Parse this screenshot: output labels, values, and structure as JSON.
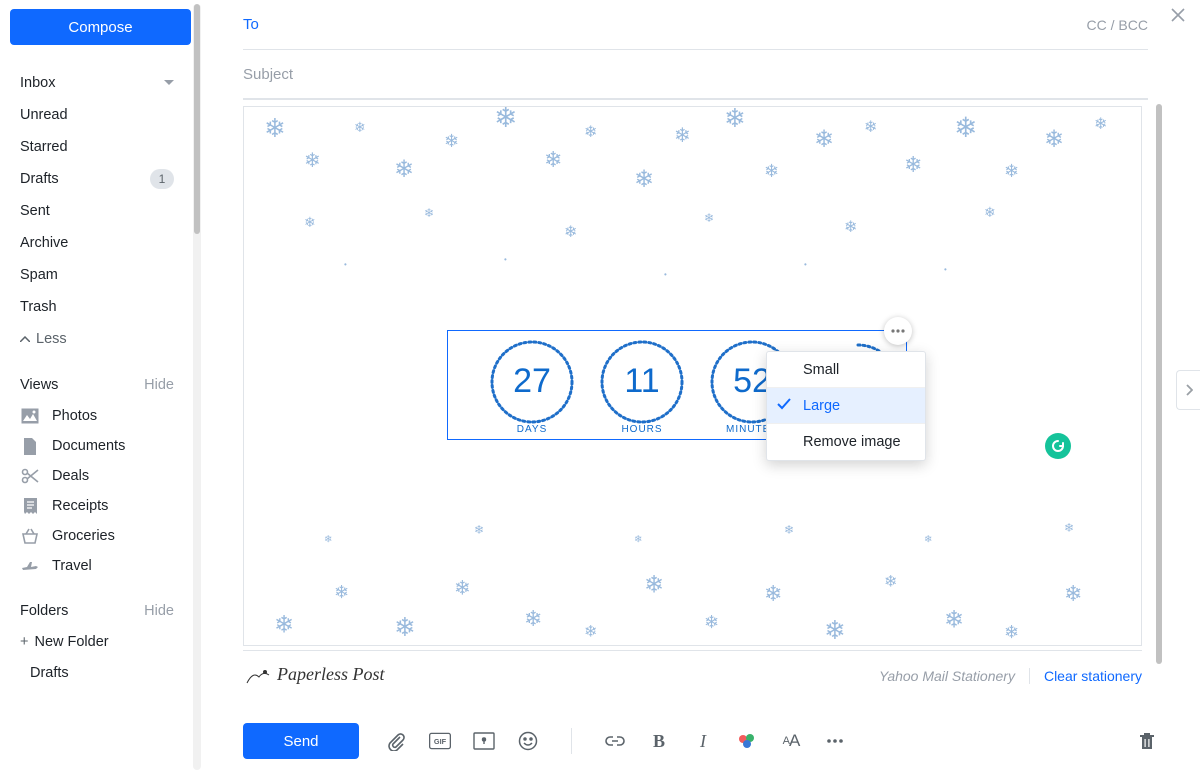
{
  "compose_button": "Compose",
  "folders": {
    "inbox": "Inbox",
    "unread": "Unread",
    "starred": "Starred",
    "drafts": "Drafts",
    "drafts_count": "1",
    "sent": "Sent",
    "archive": "Archive",
    "spam": "Spam",
    "trash": "Trash",
    "less": "Less"
  },
  "views": {
    "header": "Views",
    "hide": "Hide",
    "photos": "Photos",
    "documents": "Documents",
    "deals": "Deals",
    "receipts": "Receipts",
    "groceries": "Groceries",
    "travel": "Travel"
  },
  "folders_section": {
    "header": "Folders",
    "hide": "Hide",
    "newfolder": "New Folder",
    "drafts": "Drafts"
  },
  "compose": {
    "to_label": "To",
    "ccbcc": "CC / BCC",
    "subject_placeholder": "Subject"
  },
  "countdown": {
    "days_val": "27",
    "days_lab": "DAYS",
    "hours_val": "11",
    "hours_lab": "HOURS",
    "mins_val": "52",
    "mins_lab": "MINUTES"
  },
  "ctx": {
    "small": "Small",
    "large": "Large",
    "remove": "Remove image"
  },
  "footer": {
    "paperless": "Paperless Post",
    "yms": "Yahoo Mail Stationery",
    "clear": "Clear stationery"
  },
  "toolbar": {
    "send": "Send",
    "gif": "GIF",
    "aa": "AA"
  }
}
